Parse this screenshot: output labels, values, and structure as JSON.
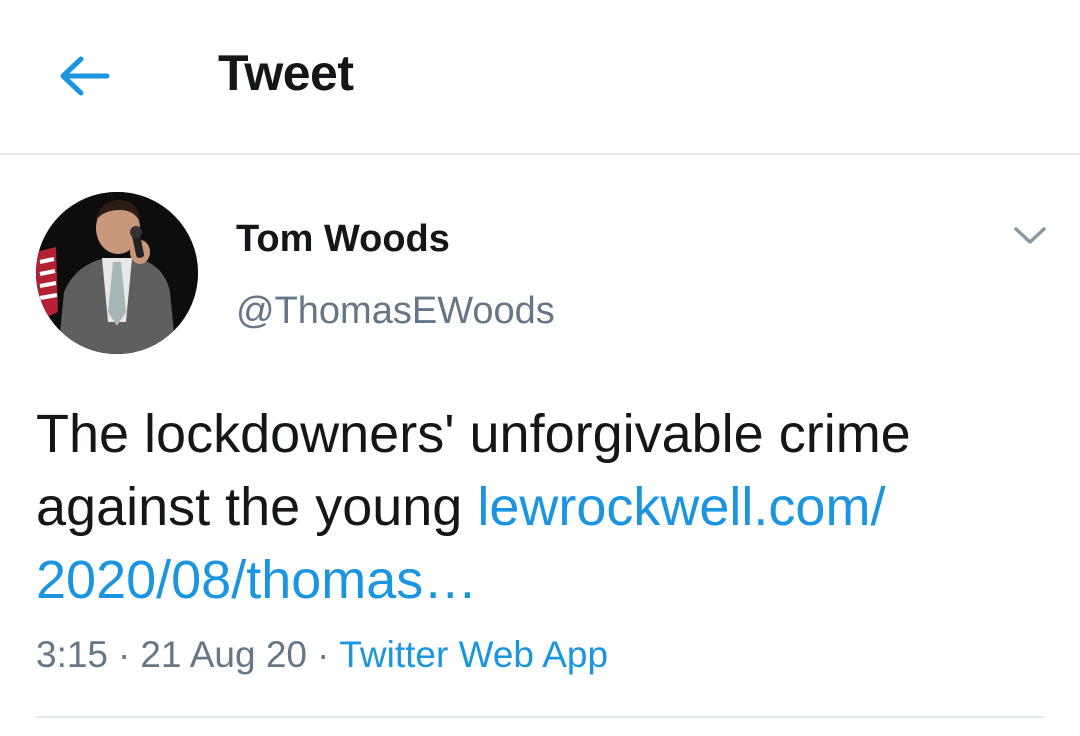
{
  "header": {
    "back_icon": "arrow-left-icon",
    "title": "Tweet",
    "accent_color": "#1b95e0"
  },
  "tweet": {
    "author_name": "Tom Woods",
    "author_handle": "@ThomasEWoods",
    "caret_icon": "chevron-down-icon",
    "text_plain": "The lockdowners' unforgivable crime against the young",
    "link_line1": "lewrockwell.com/",
    "link_line2": "2020/08/thomas…",
    "time": "3:15",
    "separator": "·",
    "date": "21 Aug 20",
    "source": "Twitter Web App"
  }
}
